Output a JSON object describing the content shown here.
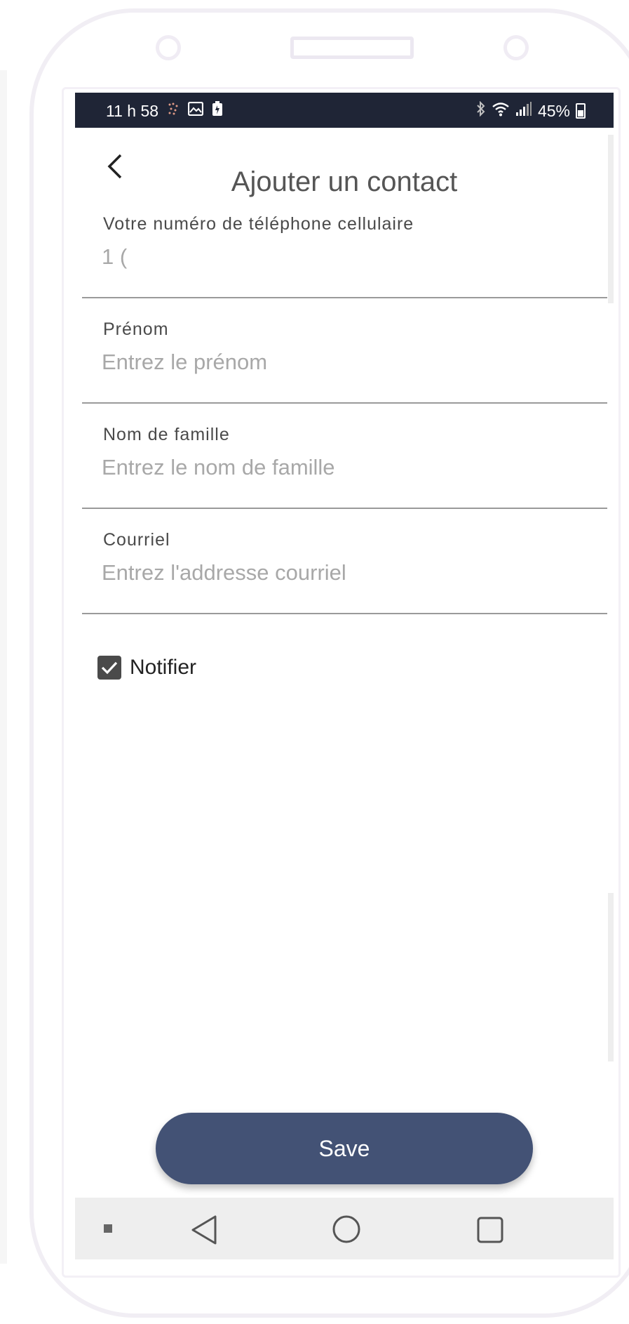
{
  "status_bar": {
    "time": "11 h 58",
    "battery_percent": "45%",
    "icons_left": [
      "activity-icon",
      "image-icon",
      "battery-saver-icon"
    ],
    "icons_right": [
      "bluetooth-icon",
      "wifi-icon",
      "signal-icon",
      "battery-icon"
    ]
  },
  "header": {
    "title": "Ajouter un contact",
    "back_icon": "chevron-left-icon"
  },
  "form": {
    "phone": {
      "label": "Votre numéro de téléphone cellulaire",
      "value": "1 (",
      "placeholder": ""
    },
    "first_name": {
      "label": "Prénom",
      "value": "",
      "placeholder": "Entrez le prénom"
    },
    "last_name": {
      "label": "Nom de famille",
      "value": "",
      "placeholder": "Entrez le nom de famille"
    },
    "email": {
      "label": "Courriel",
      "value": "",
      "placeholder": "Entrez l'addresse courriel"
    },
    "notify": {
      "label": "Notifier",
      "checked": true
    }
  },
  "actions": {
    "save_label": "Save"
  },
  "nav_bar": {
    "icons": [
      "dot-icon",
      "back-triangle-icon",
      "home-circle-icon",
      "recents-square-icon"
    ]
  },
  "colors": {
    "status_bar_bg": "#1f2536",
    "button_bg": "#435275",
    "nav_bar_bg": "#eeeeee",
    "divider": "#9a9a9a"
  }
}
